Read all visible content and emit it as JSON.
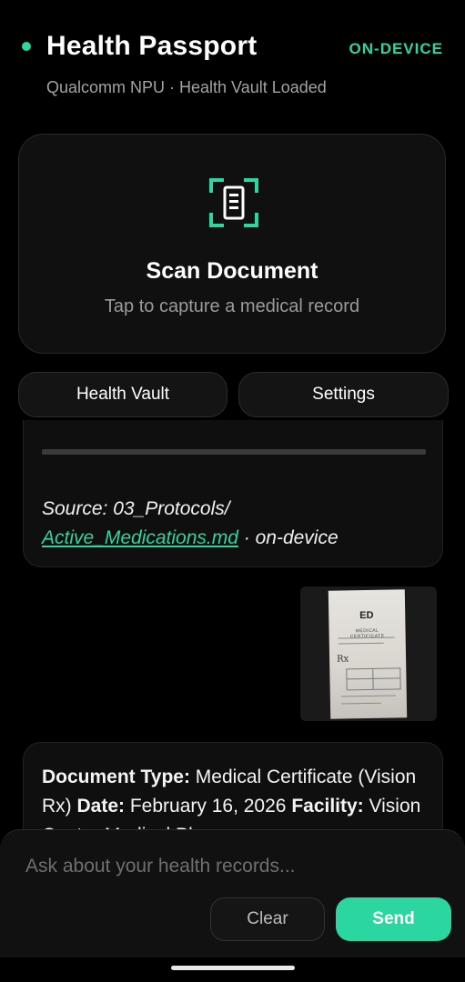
{
  "header": {
    "title": "Health Passport",
    "badge": "ON-DEVICE",
    "subtitle": "Qualcomm NPU · Health Vault Loaded"
  },
  "scan_card": {
    "icon": "document-scan-icon",
    "title": "Scan Document",
    "subtitle": "Tap to capture a medical record"
  },
  "nav": {
    "health_vault": "Health Vault",
    "settings": "Settings"
  },
  "messages": {
    "source_prefix": "Source: 03_Protocols/",
    "source_file": "Active_Medications.md",
    "source_suffix": " · on-device",
    "thumbnail": {
      "logo": "ED",
      "heading": "MEDICAL CERTIFICATE",
      "rx": "Rx"
    },
    "doc_type_label": "Document Type:",
    "doc_type_value": " Medical Certificate (Vision Rx) ",
    "date_label": "Date:",
    "date_value": " February 16, 2026",
    "facility_label": "Facility:",
    "facility_value": " Vision Center Medical Pla"
  },
  "composer": {
    "placeholder": "Ask about your health records...",
    "clear_label": "Clear",
    "send_label": "Send"
  },
  "colors": {
    "accent": "#2bd6a0",
    "background": "#000000",
    "card": "#101010"
  }
}
